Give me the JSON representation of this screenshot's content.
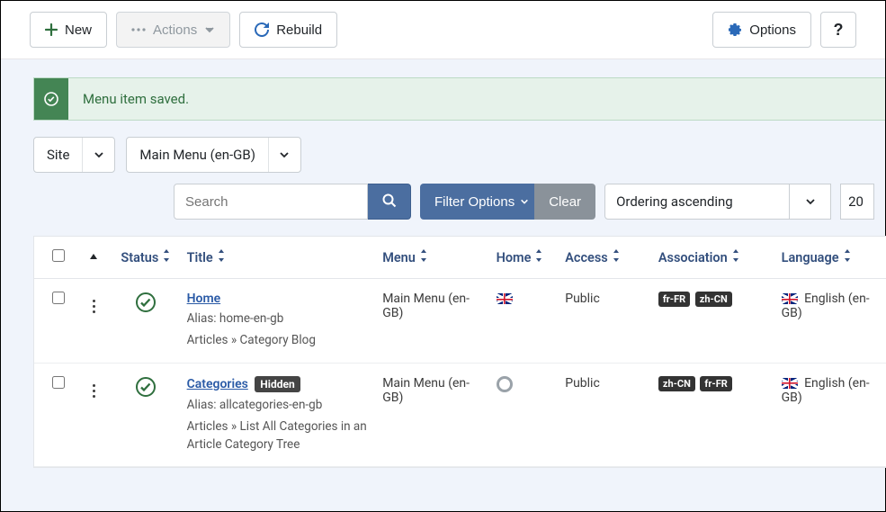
{
  "toolbar": {
    "new": "New",
    "actions": "Actions",
    "rebuild": "Rebuild",
    "options": "Options",
    "help": "?"
  },
  "alert": {
    "text": "Menu item saved."
  },
  "filters": {
    "client": "Site",
    "menu": "Main Menu (en-GB)",
    "search_placeholder": "Search",
    "filter_options": "Filter Options",
    "clear": "Clear",
    "ordering": "Ordering ascending",
    "limit": "20"
  },
  "columns": {
    "status": "Status",
    "title": "Title",
    "menu": "Menu",
    "home": "Home",
    "access": "Access",
    "association": "Association",
    "language": "Language"
  },
  "rows": [
    {
      "title": "Home",
      "hidden": false,
      "alias": "Alias: home-en-gb",
      "path": "Articles » Category Blog",
      "menu": "Main Menu (en-GB)",
      "home": "flag",
      "access": "Public",
      "assoc": [
        "fr-FR",
        "zh-CN"
      ],
      "language": "English (en-GB)"
    },
    {
      "title": "Categories",
      "hidden": true,
      "hidden_label": "Hidden",
      "alias": "Alias: allcategories-en-gb",
      "path": "Articles » List All Categories in an Article Category Tree",
      "menu": "Main Menu (en-GB)",
      "home": "radio",
      "access": "Public",
      "assoc": [
        "zh-CN",
        "fr-FR"
      ],
      "language": "English (en-GB)"
    }
  ]
}
